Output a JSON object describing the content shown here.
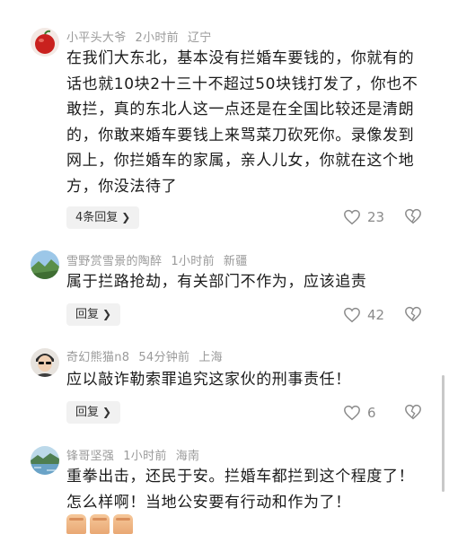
{
  "comments": [
    {
      "username": "小平头大爷",
      "time": "2小时前",
      "location": "辽宁",
      "text": "在我们大东北，基本没有拦婚车要钱的，你就有的话也就10块2十三十不超过50块钱打发了，你也不敢拦，真的东北人这一点还是在全国比较还是清朗的，你敢来婚车要钱上来骂菜刀砍死你。录像发到网上，你拦婚车的家属，亲人儿女，你就在这个地方，你没法待了",
      "reply_label": "4条回复",
      "likes": "23",
      "avatar_icon": "red-fruit-avatar"
    },
    {
      "username": "雪野赏雪景的陶醉",
      "time": "1小时前",
      "location": "新疆",
      "text": "属于拦路抢劫，有关部门不作为，应该追责",
      "reply_label": "回复",
      "likes": "42",
      "avatar_icon": "landscape-avatar"
    },
    {
      "username": "奇幻熊猫n8",
      "time": "54分钟前",
      "location": "上海",
      "text": "应以敲诈勒索罪追究这家伙的刑事责任！",
      "reply_label": "回复",
      "likes": "6",
      "avatar_icon": "person-avatar"
    },
    {
      "username": "锋哥坚强",
      "time": "1小时前",
      "location": "海南",
      "text": "重拳出击，还民于安。拦婚车都拦到这个程度了！怎么样啊！当地公安要有行动和作为了！",
      "avatar_icon": "lake-avatar"
    }
  ],
  "colors": {
    "meta": "#9a9a9a",
    "icon": "#8a8a8a",
    "reply_bg": "#f1f1f1"
  }
}
